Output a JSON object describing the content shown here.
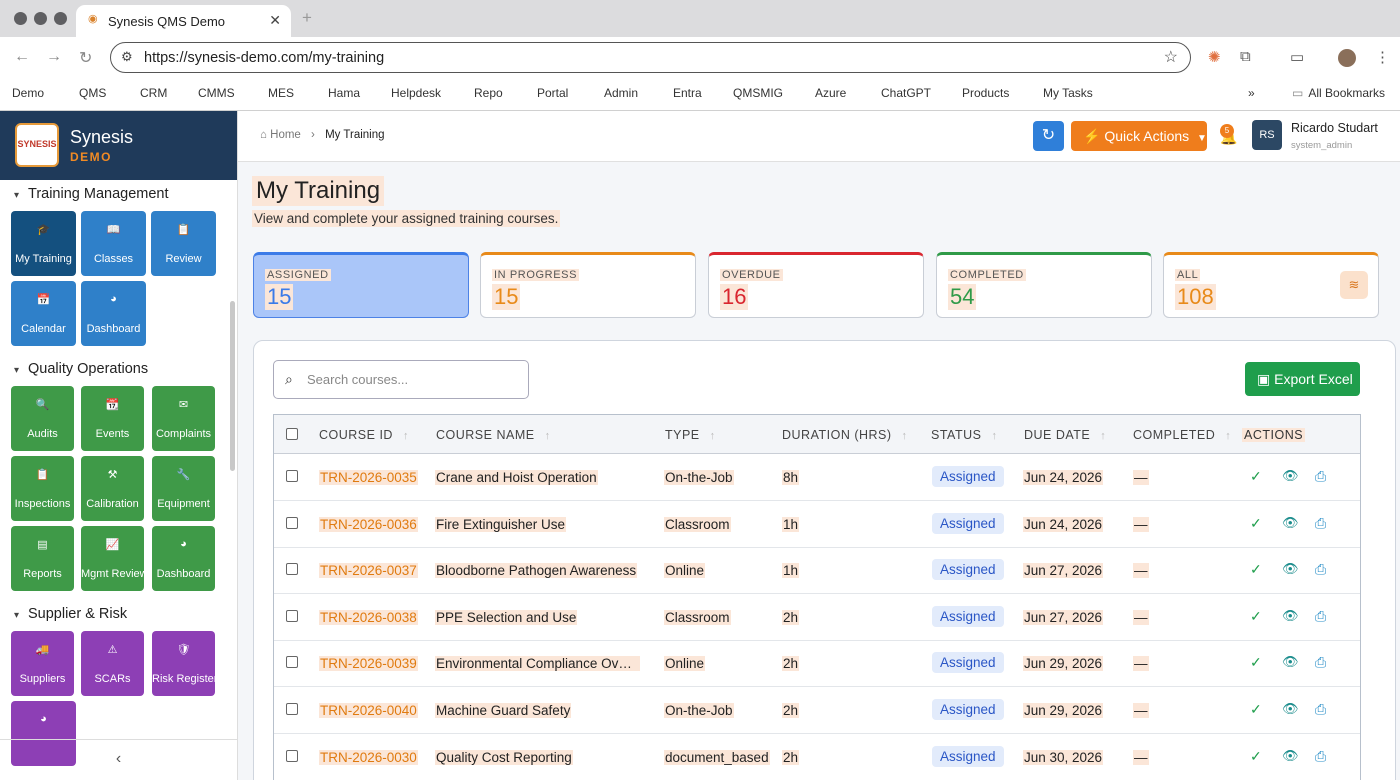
{
  "browser": {
    "tab_title": "Synesis QMS Demo",
    "url": "https://synesis-demo.com/my-training",
    "bookmarks": [
      "Demo",
      "QMS",
      "CRM",
      "CMMS",
      "MES",
      "Hama",
      "Helpdesk",
      "Repo",
      "Portal",
      "Admin",
      "Entra",
      "QMSMIG",
      "Azure",
      "ChatGPT",
      "Products",
      "My Tasks"
    ],
    "all_bookmarks": "All Bookmarks"
  },
  "brand": {
    "name": "Synesis",
    "sub": "DEMO",
    "logo_text": "SYNESIS"
  },
  "sidebar": {
    "sections": [
      {
        "title": "Training Management",
        "items": [
          "My Training",
          "Classes",
          "Review",
          "Calendar",
          "Dashboard"
        ]
      },
      {
        "title": "Quality Operations",
        "items": [
          "Audits",
          "Events",
          "Complaints",
          "Inspections",
          "Calibration",
          "Equipment",
          "Reports",
          "Mgmt Review",
          "Dashboard"
        ]
      },
      {
        "title": "Supplier & Risk",
        "items": [
          "Suppliers",
          "SCARs",
          "Risk Register"
        ]
      }
    ]
  },
  "header": {
    "breadcrumb_home": "Home",
    "breadcrumb_current": "My Training",
    "quick_actions": "Quick Actions",
    "notif_count": "5",
    "user_initials": "RS",
    "user_name": "Ricardo Studart",
    "user_role": "system_admin"
  },
  "page": {
    "title": "My Training",
    "subtitle": "View and complete your assigned training courses."
  },
  "stats": [
    {
      "label": "ASSIGNED",
      "value": "15",
      "color": "#3b7be8"
    },
    {
      "label": "IN PROGRESS",
      "value": "15",
      "color": "#e88a1a"
    },
    {
      "label": "OVERDUE",
      "value": "16",
      "color": "#d9262f"
    },
    {
      "label": "COMPLETED",
      "value": "54",
      "color": "#2f9a48"
    },
    {
      "label": "ALL",
      "value": "108",
      "color": "#e88a1a"
    }
  ],
  "search": {
    "placeholder": "Search courses..."
  },
  "export_label": "Export Excel",
  "table": {
    "columns": [
      "COURSE ID",
      "COURSE NAME",
      "TYPE",
      "DURATION (HRS)",
      "STATUS",
      "DUE DATE",
      "COMPLETED",
      "ACTIONS"
    ],
    "rows": [
      {
        "id": "TRN-2026-0035",
        "name": "Crane and Hoist Operation",
        "type": "On-the-Job",
        "duration": "8h",
        "status": "Assigned",
        "due": "Jun 24, 2026",
        "completed": "—"
      },
      {
        "id": "TRN-2026-0036",
        "name": "Fire Extinguisher Use",
        "type": "Classroom",
        "duration": "1h",
        "status": "Assigned",
        "due": "Jun 24, 2026",
        "completed": "—"
      },
      {
        "id": "TRN-2026-0037",
        "name": "Bloodborne Pathogen Awareness",
        "type": "Online",
        "duration": "1h",
        "status": "Assigned",
        "due": "Jun 27, 2026",
        "completed": "—"
      },
      {
        "id": "TRN-2026-0038",
        "name": "PPE Selection and Use",
        "type": "Classroom",
        "duration": "2h",
        "status": "Assigned",
        "due": "Jun 27, 2026",
        "completed": "—"
      },
      {
        "id": "TRN-2026-0039",
        "name": "Environmental Compliance Overvi...",
        "type": "Online",
        "duration": "2h",
        "status": "Assigned",
        "due": "Jun 29, 2026",
        "completed": "—"
      },
      {
        "id": "TRN-2026-0040",
        "name": "Machine Guard Safety",
        "type": "On-the-Job",
        "duration": "2h",
        "status": "Assigned",
        "due": "Jun 29, 2026",
        "completed": "—"
      },
      {
        "id": "TRN-2026-0030",
        "name": "Quality Cost Reporting",
        "type": "document_based",
        "duration": "2h",
        "status": "Assigned",
        "due": "Jun 30, 2026",
        "completed": "—"
      }
    ]
  }
}
